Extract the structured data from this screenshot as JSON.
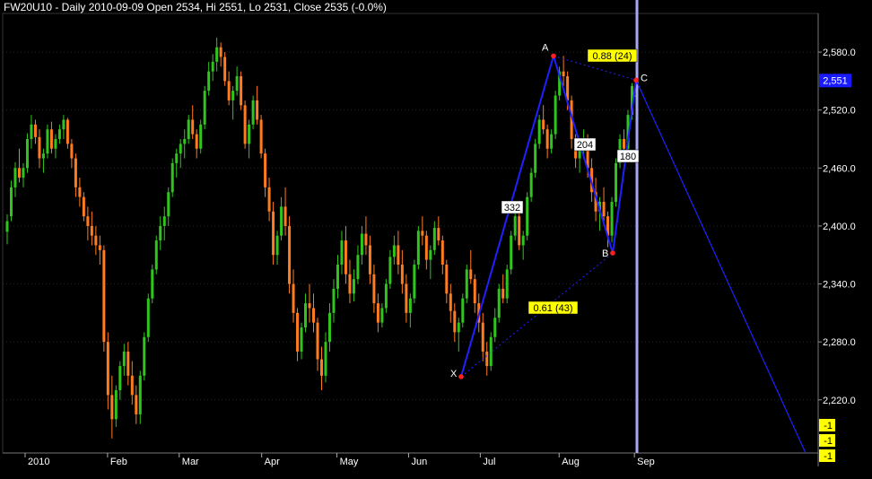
{
  "chart_data": {
    "type": "candlestick",
    "title": "FW20U10 - Daily 2010-09-09 Open 2534, Hi 2551, Lo 2531, Close 2535 (-0.0%)",
    "ylim": [
      2165,
      2620
    ],
    "y_ticks": [
      "2,580.0",
      "2,520.0",
      "2,460.0",
      "2,400.0",
      "2,340.0",
      "2,280.0",
      "2,220.0"
    ],
    "y_tick_values": [
      2580,
      2520,
      2460,
      2400,
      2340,
      2280,
      2220
    ],
    "x_ticks": [
      {
        "label": "2010",
        "day": 0
      },
      {
        "label": "Feb",
        "day": 23
      },
      {
        "label": "Mar",
        "day": 43
      },
      {
        "label": "Apr",
        "day": 66
      },
      {
        "label": "May",
        "day": 87
      },
      {
        "label": "Jun",
        "day": 107
      },
      {
        "label": "Jul",
        "day": 127
      },
      {
        "label": "Aug",
        "day": 149
      },
      {
        "label": "Sep",
        "day": 170
      }
    ],
    "candles": [
      [
        2394,
        2412,
        2381,
        2405
      ],
      [
        2410,
        2447,
        2405,
        2440
      ],
      [
        2440,
        2466,
        2430,
        2460
      ],
      [
        2460,
        2480,
        2445,
        2450
      ],
      [
        2450,
        2465,
        2440,
        2460
      ],
      [
        2460,
        2496,
        2455,
        2490
      ],
      [
        2490,
        2515,
        2480,
        2505
      ],
      [
        2505,
        2510,
        2485,
        2492
      ],
      [
        2492,
        2500,
        2460,
        2470
      ],
      [
        2470,
        2480,
        2455,
        2475
      ],
      [
        2475,
        2505,
        2470,
        2500
      ],
      [
        2500,
        2508,
        2475,
        2480
      ],
      [
        2480,
        2495,
        2470,
        2490
      ],
      [
        2490,
        2505,
        2485,
        2500
      ],
      [
        2500,
        2515,
        2490,
        2510
      ],
      [
        2510,
        2512,
        2480,
        2485
      ],
      [
        2485,
        2490,
        2460,
        2470
      ],
      [
        2470,
        2475,
        2430,
        2440
      ],
      [
        2440,
        2450,
        2420,
        2430
      ],
      [
        2430,
        2435,
        2405,
        2410
      ],
      [
        2410,
        2420,
        2385,
        2400
      ],
      [
        2400,
        2415,
        2380,
        2390
      ],
      [
        2390,
        2400,
        2370,
        2380
      ],
      [
        2380,
        2390,
        2360,
        2375
      ],
      [
        2375,
        2380,
        2270,
        2280
      ],
      [
        2280,
        2290,
        2210,
        2225
      ],
      [
        2225,
        2245,
        2180,
        2200
      ],
      [
        2200,
        2235,
        2192,
        2230
      ],
      [
        2230,
        2260,
        2220,
        2255
      ],
      [
        2255,
        2278,
        2245,
        2270
      ],
      [
        2270,
        2280,
        2235,
        2245
      ],
      [
        2245,
        2260,
        2215,
        2225
      ],
      [
        2225,
        2235,
        2195,
        2205
      ],
      [
        2205,
        2250,
        2195,
        2245
      ],
      [
        2245,
        2290,
        2240,
        2285
      ],
      [
        2285,
        2330,
        2280,
        2325
      ],
      [
        2325,
        2360,
        2320,
        2355
      ],
      [
        2355,
        2390,
        2350,
        2385
      ],
      [
        2385,
        2410,
        2375,
        2400
      ],
      [
        2400,
        2420,
        2385,
        2410
      ],
      [
        2410,
        2440,
        2400,
        2435
      ],
      [
        2435,
        2470,
        2430,
        2465
      ],
      [
        2465,
        2480,
        2450,
        2475
      ],
      [
        2475,
        2490,
        2460,
        2485
      ],
      [
        2485,
        2500,
        2470,
        2490
      ],
      [
        2490,
        2515,
        2485,
        2510
      ],
      [
        2510,
        2525,
        2490,
        2495
      ],
      [
        2495,
        2500,
        2470,
        2480
      ],
      [
        2480,
        2510,
        2475,
        2505
      ],
      [
        2505,
        2545,
        2500,
        2540
      ],
      [
        2540,
        2570,
        2535,
        2560
      ],
      [
        2560,
        2578,
        2550,
        2570
      ],
      [
        2570,
        2595,
        2560,
        2585
      ],
      [
        2585,
        2590,
        2565,
        2575
      ],
      [
        2575,
        2580,
        2545,
        2550
      ],
      [
        2550,
        2560,
        2525,
        2530
      ],
      [
        2530,
        2545,
        2510,
        2540
      ],
      [
        2540,
        2565,
        2535,
        2555
      ],
      [
        2555,
        2560,
        2520,
        2525
      ],
      [
        2525,
        2530,
        2480,
        2485
      ],
      [
        2485,
        2510,
        2470,
        2505
      ],
      [
        2505,
        2535,
        2500,
        2530
      ],
      [
        2530,
        2545,
        2505,
        2510
      ],
      [
        2510,
        2515,
        2470,
        2475
      ],
      [
        2475,
        2480,
        2430,
        2440
      ],
      [
        2440,
        2450,
        2405,
        2415
      ],
      [
        2415,
        2425,
        2360,
        2370
      ],
      [
        2370,
        2395,
        2360,
        2390
      ],
      [
        2390,
        2430,
        2385,
        2420
      ],
      [
        2420,
        2440,
        2390,
        2400
      ],
      [
        2400,
        2410,
        2330,
        2340
      ],
      [
        2340,
        2355,
        2300,
        2310
      ],
      [
        2310,
        2315,
        2260,
        2270
      ],
      [
        2270,
        2300,
        2262,
        2295
      ],
      [
        2295,
        2330,
        2290,
        2320
      ],
      [
        2320,
        2340,
        2300,
        2315
      ],
      [
        2315,
        2330,
        2290,
        2300
      ],
      [
        2300,
        2305,
        2250,
        2262
      ],
      [
        2262,
        2275,
        2230,
        2245
      ],
      [
        2245,
        2290,
        2238,
        2280
      ],
      [
        2280,
        2320,
        2270,
        2310
      ],
      [
        2310,
        2345,
        2300,
        2335
      ],
      [
        2335,
        2370,
        2325,
        2360
      ],
      [
        2360,
        2395,
        2350,
        2385
      ],
      [
        2385,
        2400,
        2340,
        2350
      ],
      [
        2350,
        2365,
        2320,
        2330
      ],
      [
        2330,
        2355,
        2322,
        2345
      ],
      [
        2345,
        2380,
        2340,
        2370
      ],
      [
        2370,
        2400,
        2360,
        2392
      ],
      [
        2392,
        2410,
        2370,
        2380
      ],
      [
        2380,
        2390,
        2340,
        2350
      ],
      [
        2350,
        2360,
        2310,
        2320
      ],
      [
        2320,
        2330,
        2290,
        2300
      ],
      [
        2300,
        2320,
        2295,
        2315
      ],
      [
        2315,
        2345,
        2310,
        2340
      ],
      [
        2340,
        2375,
        2335,
        2368
      ],
      [
        2368,
        2390,
        2360,
        2380
      ],
      [
        2380,
        2395,
        2350,
        2360
      ],
      [
        2360,
        2375,
        2330,
        2340
      ],
      [
        2340,
        2350,
        2300,
        2310
      ],
      [
        2310,
        2330,
        2295,
        2325
      ],
      [
        2325,
        2365,
        2320,
        2360
      ],
      [
        2360,
        2400,
        2355,
        2395
      ],
      [
        2395,
        2410,
        2380,
        2390
      ],
      [
        2390,
        2395,
        2355,
        2365
      ],
      [
        2365,
        2380,
        2345,
        2375
      ],
      [
        2375,
        2405,
        2370,
        2398
      ],
      [
        2398,
        2410,
        2380,
        2385
      ],
      [
        2385,
        2390,
        2350,
        2360
      ],
      [
        2360,
        2365,
        2320,
        2330
      ],
      [
        2330,
        2340,
        2300,
        2312
      ],
      [
        2312,
        2320,
        2280,
        2290
      ],
      [
        2290,
        2305,
        2270,
        2300
      ],
      [
        2300,
        2330,
        2295,
        2325
      ],
      [
        2325,
        2360,
        2320,
        2355
      ],
      [
        2355,
        2375,
        2340,
        2345
      ],
      [
        2345,
        2350,
        2310,
        2320
      ],
      [
        2320,
        2330,
        2290,
        2300
      ],
      [
        2300,
        2310,
        2260,
        2270
      ],
      [
        2270,
        2280,
        2245,
        2255
      ],
      [
        2255,
        2290,
        2250,
        2285
      ],
      [
        2285,
        2315,
        2280,
        2305
      ],
      [
        2305,
        2340,
        2300,
        2335
      ],
      [
        2335,
        2350,
        2320,
        2325
      ],
      [
        2325,
        2360,
        2320,
        2355
      ],
      [
        2355,
        2395,
        2350,
        2390
      ],
      [
        2390,
        2420,
        2385,
        2410
      ],
      [
        2410,
        2415,
        2375,
        2380
      ],
      [
        2380,
        2395,
        2365,
        2390
      ],
      [
        2390,
        2435,
        2385,
        2430
      ],
      [
        2430,
        2460,
        2425,
        2455
      ],
      [
        2455,
        2490,
        2450,
        2485
      ],
      [
        2485,
        2515,
        2480,
        2510
      ],
      [
        2510,
        2525,
        2495,
        2500
      ],
      [
        2500,
        2505,
        2470,
        2480
      ],
      [
        2480,
        2500,
        2475,
        2495
      ],
      [
        2495,
        2540,
        2490,
        2535
      ],
      [
        2535,
        2565,
        2530,
        2560
      ],
      [
        2560,
        2576,
        2545,
        2555
      ],
      [
        2555,
        2560,
        2520,
        2530
      ],
      [
        2530,
        2535,
        2480,
        2490
      ],
      [
        2490,
        2495,
        2460,
        2470
      ],
      [
        2470,
        2485,
        2455,
        2480
      ],
      [
        2480,
        2500,
        2470,
        2490
      ],
      [
        2490,
        2495,
        2450,
        2460
      ],
      [
        2460,
        2470,
        2425,
        2435
      ],
      [
        2435,
        2450,
        2405,
        2415
      ],
      [
        2415,
        2430,
        2395,
        2425
      ],
      [
        2425,
        2440,
        2400,
        2410
      ],
      [
        2410,
        2415,
        2378,
        2390
      ],
      [
        2390,
        2430,
        2383,
        2425
      ],
      [
        2425,
        2470,
        2420,
        2465
      ],
      [
        2465,
        2495,
        2460,
        2490
      ],
      [
        2490,
        2500,
        2470,
        2480
      ],
      [
        2480,
        2520,
        2475,
        2515
      ],
      [
        2515,
        2548,
        2510,
        2545
      ],
      [
        2534,
        2551,
        2531,
        2535
      ]
    ],
    "colors": {
      "up": "#2fc51d",
      "down": "#ff7b1f",
      "pattern": "#2020ff",
      "grid": "#2a2a2a",
      "cursor": "#a8a8f0"
    },
    "pattern_points": [
      {
        "label": "X",
        "day": 146,
        "value": 2244
      },
      {
        "label": "A",
        "day": 167,
        "value": 2576
      },
      {
        "label": "B",
        "day": 186,
        "value": 2372
      },
      {
        "label": "C",
        "day": 190,
        "value": 2551
      }
    ],
    "projection_end": {
      "day": 240,
      "value": 2176
    },
    "leg_labels": [
      "332",
      "204",
      "180"
    ],
    "ratio_labels": [
      "0.88 (24)",
      "0.61 (43)"
    ],
    "last_price_label": "2,551",
    "indicator_labels": [
      "-1",
      "-1",
      "-1"
    ]
  }
}
